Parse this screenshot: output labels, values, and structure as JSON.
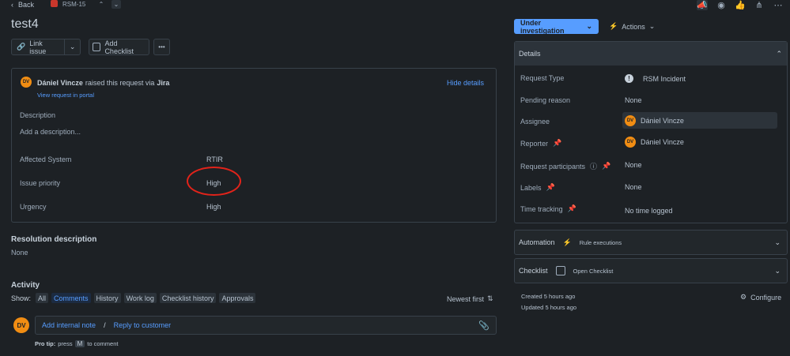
{
  "topbar": {
    "back_label": "Back",
    "issue_key": "RSM-15",
    "icons": [
      "megaphone-icon",
      "eye-icon",
      "thumbs-up-icon",
      "share-icon",
      "more-icon"
    ]
  },
  "issue": {
    "title": "test4"
  },
  "toolbar": {
    "link_issue": "Link issue",
    "add_checklist": "Add Checklist",
    "more": "•••"
  },
  "request": {
    "avatar": "DV",
    "reporter": "Dániel Vincze",
    "raised_text": "raised this request via",
    "via": "Jira",
    "view_portal": "View request in portal",
    "hide_details": "Hide details",
    "description_label": "Description",
    "description_placeholder": "Add a description...",
    "fields": [
      {
        "label": "Affected System",
        "value": "RTIR"
      },
      {
        "label": "Issue priority",
        "value": "High"
      },
      {
        "label": "Urgency",
        "value": "High"
      }
    ]
  },
  "resolution": {
    "heading": "Resolution description",
    "value": "None"
  },
  "activity": {
    "heading": "Activity",
    "show_label": "Show:",
    "filters": [
      "All",
      "Comments",
      "History",
      "Work log",
      "Checklist history",
      "Approvals"
    ],
    "selected_filter": "Comments",
    "sort_label": "Newest first",
    "avatar": "DV",
    "add_internal_note": "Add internal note",
    "separator": "/",
    "reply_to_customer": "Reply to customer",
    "protip_bold": "Pro tip:",
    "protip_press": "press",
    "protip_key": "M",
    "protip_rest": "to comment"
  },
  "sidebar": {
    "status": "Under investigation",
    "actions": "Actions",
    "details_heading": "Details",
    "rows": [
      {
        "label": "Request Type",
        "value": "RSM Incident"
      },
      {
        "label": "Pending reason",
        "value": "None"
      },
      {
        "label": "Assignee",
        "value": "Dániel Vincze",
        "avatar": "DV"
      },
      {
        "label": "Reporter",
        "value": "Dániel Vincze",
        "avatar": "DV"
      },
      {
        "label": "Request participants",
        "value": "None"
      },
      {
        "label": "Labels",
        "value": "None"
      },
      {
        "label": "Time tracking",
        "value": "No time logged"
      }
    ],
    "automation": {
      "label": "Automation",
      "sub": "Rule executions"
    },
    "checklist": {
      "label": "Checklist",
      "sub": "Open Checklist"
    },
    "created": "Created 5 hours ago",
    "updated": "Updated 5 hours ago",
    "configure": "Configure"
  }
}
